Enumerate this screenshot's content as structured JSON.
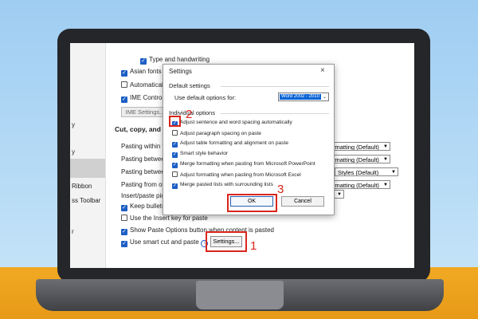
{
  "colors": {
    "accent": "#1d5fc4",
    "annotation_red": "#d9261c",
    "desk": "#f1a923",
    "sky": "#a9d3f4"
  },
  "nav": {
    "items": [
      "",
      "y",
      "y",
      "Ribbon",
      "ss Toolbar",
      "r"
    ]
  },
  "options_top": [
    {
      "label": "Type and handwriting",
      "checked": true
    },
    {
      "label": "Asian fonts also apply to Latin text",
      "checked": true
    },
    {
      "label": "Automatically switch keyboard to match the language",
      "checked": false
    },
    {
      "label": "IME Control Active",
      "checked": true
    }
  ],
  "ime_settings_label": "IME Settings...",
  "section_title": "Cut, copy, and paste",
  "paste_rows": [
    {
      "label": "Pasting within the same document",
      "value": "rmatting (Default)"
    },
    {
      "label": "Pasting between documents",
      "value": "rmatting (Default)"
    },
    {
      "label": "Pasting between documents when style definitions conflict",
      "value": "Styles (Default)"
    },
    {
      "label": "Pasting from other programs",
      "value": "rmatting (Default)"
    }
  ],
  "insert_paste_label": "Insert/paste pictures as:",
  "options_bottom": [
    {
      "label": "Keep bullets and numbers when pasting text with Keep Text Only option",
      "checked": true
    },
    {
      "label": "Use the Insert key for paste",
      "checked": false
    },
    {
      "label": "Show Paste Options button when content is pasted",
      "checked": true
    },
    {
      "label": "Use smart cut and paste",
      "checked": true
    }
  ],
  "settings_button": "Settings...",
  "annotations": [
    "1",
    "2",
    "3"
  ],
  "dialog": {
    "title": "Settings",
    "close": "×",
    "default_group": "Default settings",
    "use_default_label": "Use default options for:",
    "default_value": "Word 2002 - 2010",
    "individual_group": "Individual options",
    "options": [
      {
        "label": "Adjust sentence and word spacing automatically",
        "checked": true
      },
      {
        "label": "Adjust paragraph spacing on paste",
        "checked": false
      },
      {
        "label": "Adjust table formatting and alignment on paste",
        "checked": true
      },
      {
        "label": "Smart style behavior",
        "checked": true
      },
      {
        "label": "Merge formatting when pasting from Microsoft PowerPoint",
        "checked": true
      },
      {
        "label": "Adjust formatting when pasting from Microsoft Excel",
        "checked": false
      },
      {
        "label": "Merge pasted lists with surrounding lists",
        "checked": true
      }
    ],
    "ok": "OK",
    "cancel": "Cancel"
  }
}
